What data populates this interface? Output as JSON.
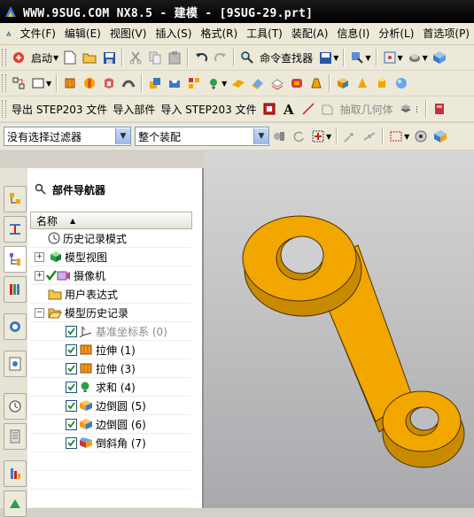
{
  "window": {
    "title": "WWW.9SUG.COM NX8.5 - 建模 - [9SUG-29.prt]"
  },
  "menubar": {
    "items": [
      "文件(F)",
      "编辑(E)",
      "视图(V)",
      "插入(S)",
      "格式(R)",
      "工具(T)",
      "装配(A)",
      "信息(I)",
      "分析(L)",
      "首选项(P)"
    ]
  },
  "toolbar_1": {
    "start_label": "启动",
    "command_finder_label": "命令查找器"
  },
  "toolbar_3": {
    "export_step_label": "导出 STEP203 文件",
    "import_part_label": "导入部件",
    "import_step_label": "导入 STEP203 文件",
    "extract_geometry_label": "抽取几何体"
  },
  "selection_bar": {
    "filter_value": "没有选择过滤器",
    "scope_value": "整个装配"
  },
  "part_navigator": {
    "title": "部件导航器",
    "column_name": "名称",
    "nodes": [
      {
        "label": "历史记录模式",
        "icon": "clock-icon"
      },
      {
        "label": "模型视图",
        "icon": "model-view-icon"
      },
      {
        "label": "摄像机",
        "icon": "camera-icon"
      },
      {
        "label": "用户表达式",
        "icon": "folder-icon"
      },
      {
        "label": "模型历史记录",
        "icon": "folder-open-icon"
      },
      {
        "label": "基准坐标系 (0)",
        "icon": "datum-csys-icon"
      },
      {
        "label": "拉伸 (1)",
        "icon": "extrude-icon"
      },
      {
        "label": "拉伸 (3)",
        "icon": "extrude-icon"
      },
      {
        "label": "求和 (4)",
        "icon": "unite-icon"
      },
      {
        "label": "边倒圆 (5)",
        "icon": "edge-blend-icon"
      },
      {
        "label": "边倒圆 (6)",
        "icon": "edge-blend-icon"
      },
      {
        "label": "倒斜角 (7)",
        "icon": "chamfer-icon"
      }
    ]
  },
  "colors": {
    "model": "#f2a600",
    "model_edge": "#4a3200",
    "title_bg": "#000000",
    "check": "#1a8a1a"
  }
}
